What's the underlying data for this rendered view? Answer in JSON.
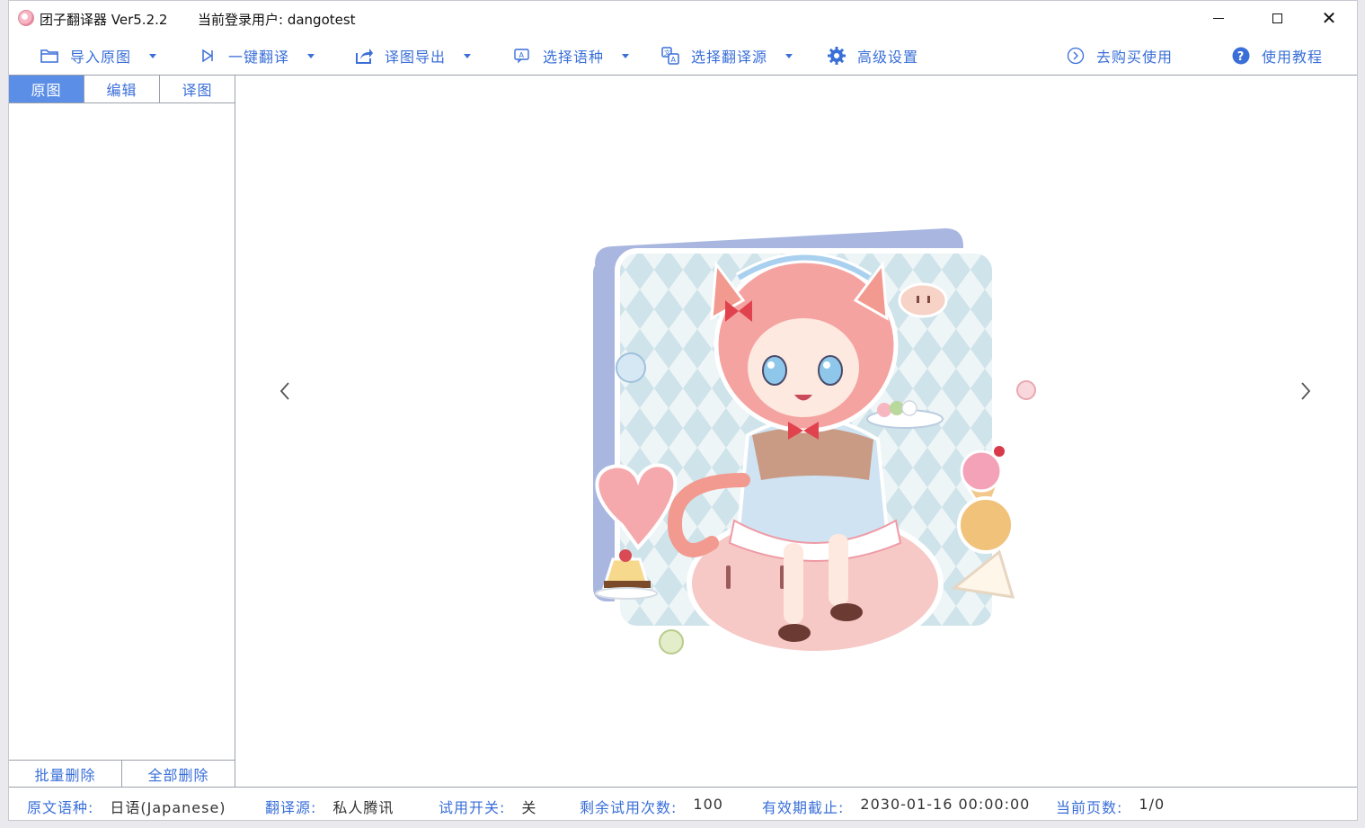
{
  "titlebar": {
    "app_title": "团子翻译器 Ver5.2.2",
    "login_user": "当前登录用户: dangotest",
    "minimize_glyph": "",
    "maximize_glyph": "",
    "close_glyph": "✕"
  },
  "toolbar": {
    "import_label": "导入原图",
    "translate_label": "一键翻译",
    "export_label": "译图导出",
    "language_label": "选择语种",
    "source_label": "选择翻译源",
    "settings_label": "高级设置",
    "buy_label": "去购买使用",
    "tutorial_label": "使用教程"
  },
  "left_panel": {
    "tabs": [
      {
        "label": "原图",
        "active": true
      },
      {
        "label": "编辑",
        "active": false
      },
      {
        "label": "译图",
        "active": false
      }
    ],
    "batch_delete_label": "批量删除",
    "delete_all_label": "全部删除"
  },
  "viewer": {
    "prev_glyph": "‹",
    "next_glyph": "›"
  },
  "statusbar": {
    "source_lang_label": "原文语种:",
    "source_lang_value": "日语(Japanese)",
    "engine_label": "翻译源:",
    "engine_value": "私人腾讯",
    "trial_label": "试用开关:",
    "trial_value": "关",
    "remaining_label": "剩余试用次数:",
    "remaining_value": "100",
    "expiry_label": "有效期截止:",
    "expiry_value": "2030-01-16 00:00:00",
    "page_label": "当前页数:",
    "page_value": "1/0"
  },
  "colors": {
    "accent": "#3a6fd8",
    "tab_active_bg": "#5b8ee6"
  }
}
